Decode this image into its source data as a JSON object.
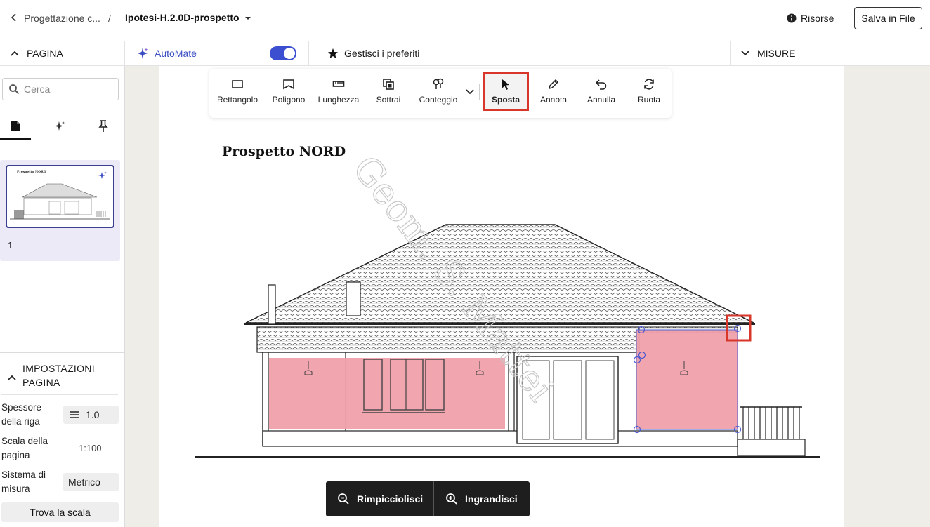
{
  "header": {
    "breadcrumb_parent": "Progettazione c...",
    "breadcrumb_separator": "/",
    "document_title": "Ipotesi-H.2.0D-prospetto",
    "resources_label": "Risorse",
    "save_label": "Salva in File"
  },
  "subbar": {
    "page_section": "PAGINA",
    "automate_label": "AutoMate",
    "automate_enabled": true,
    "favorites_label": "Gestisci i preferiti",
    "measures_section": "MISURE"
  },
  "sidebar": {
    "search_placeholder": "Cerca",
    "tabs": [
      "pages-icon",
      "sparkle-icon",
      "pin-icon"
    ],
    "thumbnail_page_number": "1",
    "thumbnail_title": "Prospetto NORD",
    "settings": {
      "title": "IMPOSTAZIONI PAGINA",
      "line_thickness_label": "Spessore della riga",
      "line_thickness_value": "1.0",
      "page_scale_label": "Scala della pagina",
      "page_scale_value": "1:100",
      "measure_system_label": "Sistema di misura",
      "measure_system_value": "Metrico",
      "find_scale_label": "Trova la scala"
    }
  },
  "toolbar": {
    "tools": [
      {
        "label": "Rettangolo",
        "icon": "rectangle-icon"
      },
      {
        "label": "Poligono",
        "icon": "polygon-icon"
      },
      {
        "label": "Lunghezza",
        "icon": "ruler-icon"
      },
      {
        "label": "Sottrai",
        "icon": "subtract-icon"
      },
      {
        "label": "Conteggio",
        "icon": "count-icon"
      },
      {
        "label": "Sposta",
        "icon": "cursor-icon",
        "active": true
      },
      {
        "label": "Annota",
        "icon": "pencil-icon"
      },
      {
        "label": "Annulla",
        "icon": "undo-icon"
      },
      {
        "label": "Ruota",
        "icon": "rotate-icon"
      }
    ]
  },
  "drawing": {
    "title": "Prospetto NORD",
    "watermark": "Geom. S. Mattei"
  },
  "zoom": {
    "zoom_out_label": "Rimpicciolisci",
    "zoom_in_label": "Ingrandisci"
  },
  "colors": {
    "accent": "#3b4fd0",
    "highlight": "#d8362a",
    "area_fill": "#f0a0aa"
  }
}
